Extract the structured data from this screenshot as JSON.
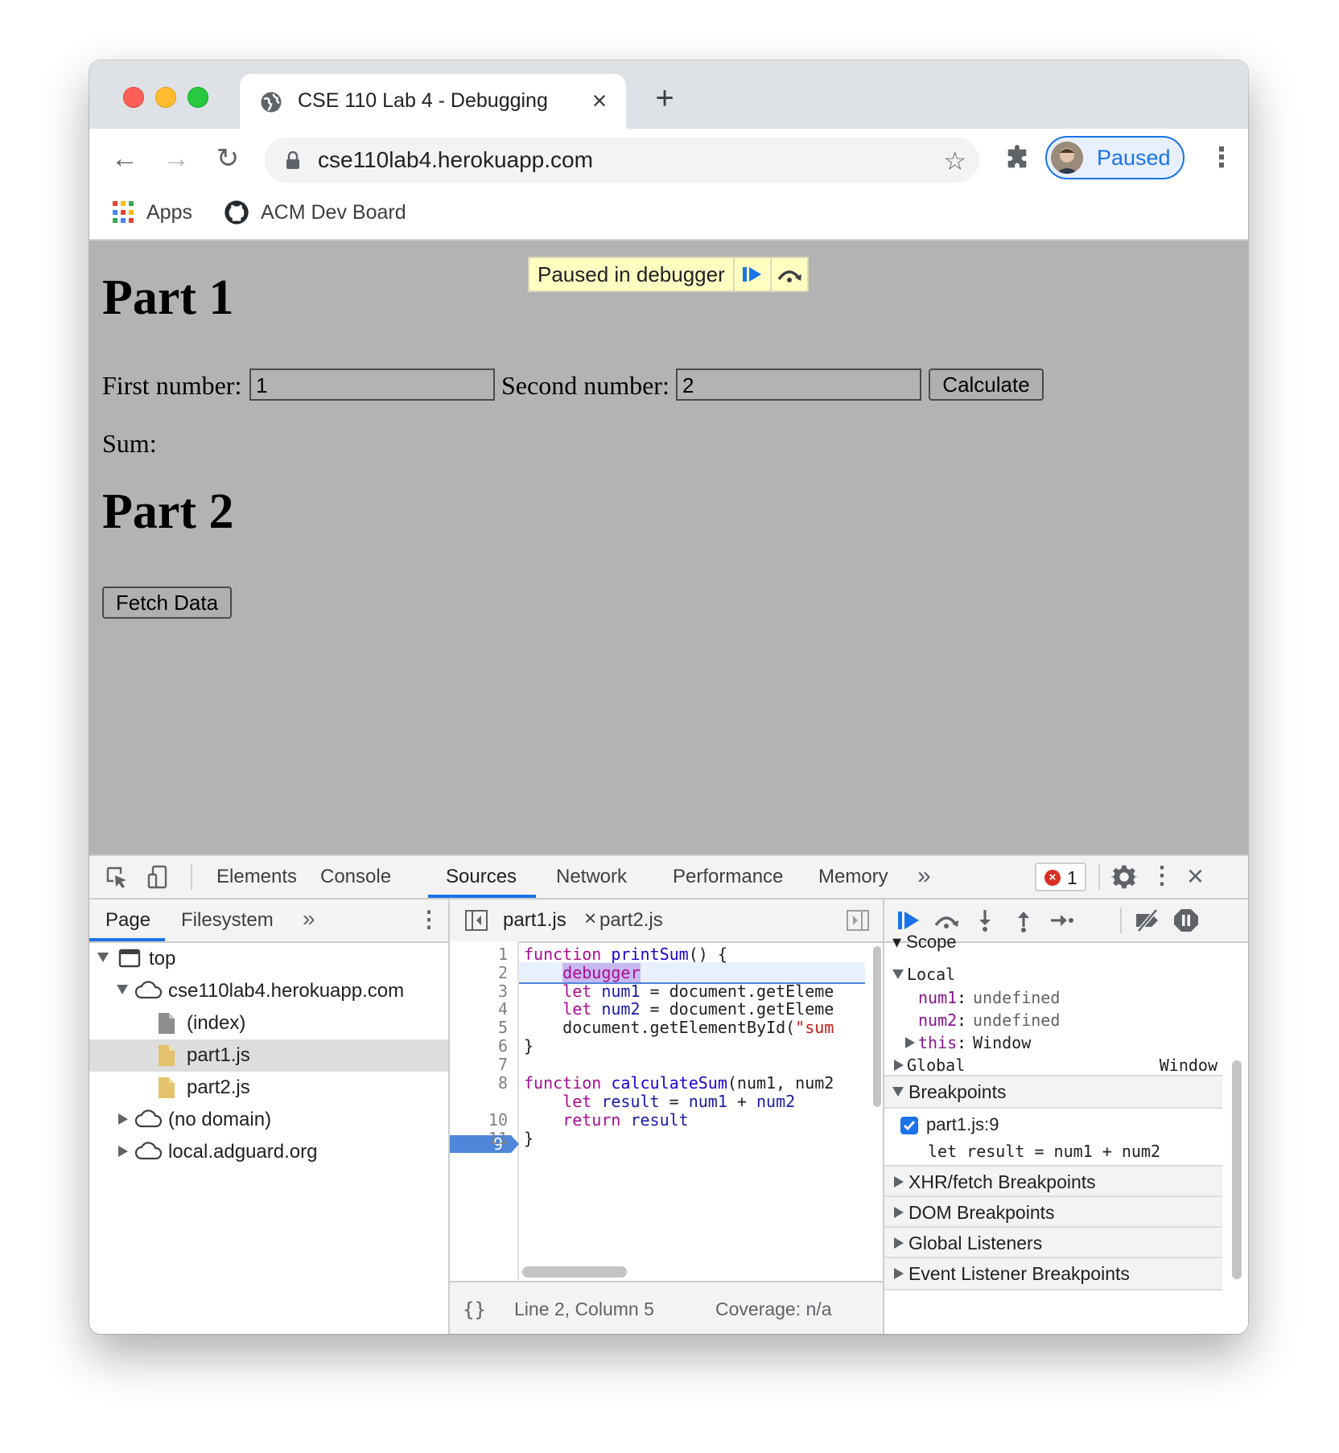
{
  "browser": {
    "tab_title": "CSE 110 Lab 4 - Debugging",
    "url": "cse110lab4.herokuapp.com",
    "profile_label": "Paused",
    "bookmarks": [
      "Apps",
      "ACM Dev Board"
    ]
  },
  "page": {
    "heading1": "Part 1",
    "first_label": "First number:",
    "first_value": "1",
    "second_label": "Second number:",
    "second_value": "2",
    "calculate_label": "Calculate",
    "sum_label": "Sum:",
    "heading2": "Part 2",
    "fetch_label": "Fetch Data",
    "paused_banner": "Paused in debugger"
  },
  "devtools": {
    "tabs": [
      "Elements",
      "Console",
      "Sources",
      "Network",
      "Performance",
      "Memory"
    ],
    "active_tab": "Sources",
    "error_count": "1",
    "navigator": {
      "tabs": [
        "Page",
        "Filesystem"
      ],
      "tree": [
        {
          "label": "top"
        },
        {
          "label": "cse110lab4.herokuapp.com"
        },
        {
          "label": "(index)"
        },
        {
          "label": "part1.js"
        },
        {
          "label": "part2.js"
        },
        {
          "label": "(no domain)"
        },
        {
          "label": "local.adguard.org"
        }
      ]
    },
    "editor": {
      "tabs": [
        "part1.js",
        "part2.js"
      ],
      "line_numbers": [
        "1",
        "2",
        "3",
        "4",
        "5",
        "6",
        "7",
        "8",
        "9",
        "10",
        "11"
      ],
      "breakpoint_line": "9",
      "status_position": "Line 2, Column 5",
      "status_coverage": "Coverage: n/a",
      "status_braces": "{}",
      "code": {
        "l1_kw": "function",
        "l1_fn": "printSum",
        "l1_rest": "() {",
        "l2_kw": "debugger",
        "l3_kw": "let",
        "l3_var": "num1",
        "l3_rest": " = document.getEleme",
        "l4_kw": "let",
        "l4_var": "num2",
        "l4_rest": " = document.getEleme",
        "l5_rest": "document.getElementById(",
        "l5_str": "\"sum",
        "l6": "}",
        "l8_kw": "function",
        "l8_fn": "calculateSum",
        "l8_rest": "(num1, num2",
        "l9_kw": "let",
        "l9_var": "result",
        "l9_eq": " = ",
        "l9_a": "num1",
        "l9_plus": " + ",
        "l9_b": "num2",
        "l10_kw": "return",
        "l10_var": "result",
        "l11": "}"
      }
    },
    "sidebar": {
      "scope_peek": "Scope",
      "local": "Local",
      "num1_name": "num1",
      "num1_val": "undefined",
      "num2_name": "num2",
      "num2_val": "undefined",
      "this_name": "this",
      "this_val": "Window",
      "global_name": "Global",
      "global_val": "Window",
      "breakpoints": "Breakpoints",
      "bp_file": "part1.js:9",
      "bp_code": "let result = num1 + num2",
      "xhr": "XHR/fetch Breakpoints",
      "dom": "DOM Breakpoints",
      "global_listeners": "Global Listeners",
      "event_listeners": "Event Listener Breakpoints"
    }
  }
}
